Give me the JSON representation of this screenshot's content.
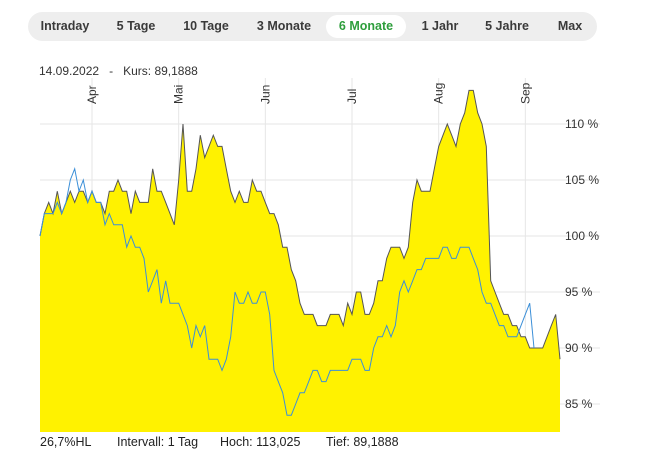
{
  "tabs": [
    {
      "label": "Intraday",
      "active": false
    },
    {
      "label": "5 Tage",
      "active": false
    },
    {
      "label": "10 Tage",
      "active": false
    },
    {
      "label": "3 Monate",
      "active": false
    },
    {
      "label": "6 Monate",
      "active": true
    },
    {
      "label": "1 Jahr",
      "active": false
    },
    {
      "label": "5 Jahre",
      "active": false
    },
    {
      "label": "Max",
      "active": false
    }
  ],
  "header": {
    "date": "14.09.2022",
    "separator": "-",
    "kurs_label": "Kurs:",
    "kurs_value": "89,1888"
  },
  "footer": {
    "range": "26,7%HL",
    "interval_label": "Intervall:",
    "interval_value": "1 Tag",
    "hoch_label": "Hoch:",
    "hoch_value": "113,025",
    "tief_label": "Tief:",
    "tief_value": "89,1888"
  },
  "colors": {
    "area_fill": "#fff200",
    "area_line": "#555555",
    "benchmark_line": "#3b8fd8",
    "active_tab": "#2e9e3c",
    "grid": "#e6e6e6"
  },
  "chart_data": {
    "type": "area",
    "y_unit": "%",
    "ylim": [
      82.5,
      112.5
    ],
    "yticks": [
      {
        "value": 85,
        "label": "85 %"
      },
      {
        "value": 90,
        "label": "90 %"
      },
      {
        "value": 95,
        "label": "95 %"
      },
      {
        "value": 100,
        "label": "100 %"
      },
      {
        "value": 105,
        "label": "105 %"
      },
      {
        "value": 110,
        "label": "110 %"
      }
    ],
    "x_month_labels": [
      {
        "label": "Apr",
        "index": 12
      },
      {
        "label": "Mai",
        "index": 32
      },
      {
        "label": "Jun",
        "index": 52
      },
      {
        "label": "Jul",
        "index": 72
      },
      {
        "label": "Aug",
        "index": 92
      },
      {
        "label": "Sep",
        "index": 112
      }
    ],
    "grid": true,
    "series": [
      {
        "role": "area",
        "values": [
          100,
          102,
          103,
          102,
          104,
          102,
          103,
          104,
          103,
          104,
          104,
          103,
          104,
          103,
          103,
          102,
          104,
          104,
          105,
          104,
          104,
          102,
          104,
          103,
          103,
          103,
          106,
          104,
          104,
          103,
          102,
          101,
          105,
          110,
          104,
          104,
          106,
          109,
          107,
          108,
          109,
          108,
          108,
          106,
          104,
          103,
          104,
          103,
          103,
          105,
          104,
          104,
          103,
          102,
          102,
          101,
          99,
          99,
          97,
          96,
          94,
          93,
          93,
          93,
          92,
          92,
          92,
          93,
          93,
          93,
          92,
          94,
          93,
          95,
          95,
          93,
          93,
          94,
          96,
          96,
          98,
          99,
          99,
          99,
          98,
          99,
          103,
          105,
          104,
          104,
          104,
          106,
          108,
          109,
          110,
          109,
          108,
          110,
          111,
          113,
          113,
          111,
          110,
          108,
          96,
          95,
          94,
          93,
          93,
          92,
          92,
          91,
          91,
          90,
          90,
          90,
          90,
          91,
          92,
          93,
          89
        ]
      },
      {
        "role": "line",
        "values": [
          100,
          102,
          102,
          102,
          103,
          102,
          103,
          105,
          106,
          104,
          105,
          103,
          104,
          103,
          103,
          101,
          102,
          101,
          101,
          101,
          99,
          100,
          99,
          99,
          98,
          95,
          96,
          97,
          94,
          96,
          94,
          94,
          94,
          93,
          92,
          90,
          92,
          91,
          92,
          89,
          89,
          89,
          88,
          89,
          91,
          95,
          94,
          94,
          95,
          94,
          94,
          95,
          95,
          93,
          88,
          87,
          86,
          84,
          84,
          85,
          86,
          86,
          87,
          88,
          88,
          87,
          87,
          88,
          88,
          88,
          88,
          88,
          89,
          89,
          89,
          88,
          88,
          90,
          91,
          91,
          92,
          91,
          92,
          95,
          96,
          95,
          96,
          97,
          97,
          98,
          98,
          98,
          98,
          99,
          99,
          98,
          98,
          99,
          99,
          99,
          98,
          97,
          95,
          94,
          94,
          93,
          92,
          92,
          91,
          91,
          91,
          92,
          93,
          94,
          90
        ]
      }
    ]
  }
}
